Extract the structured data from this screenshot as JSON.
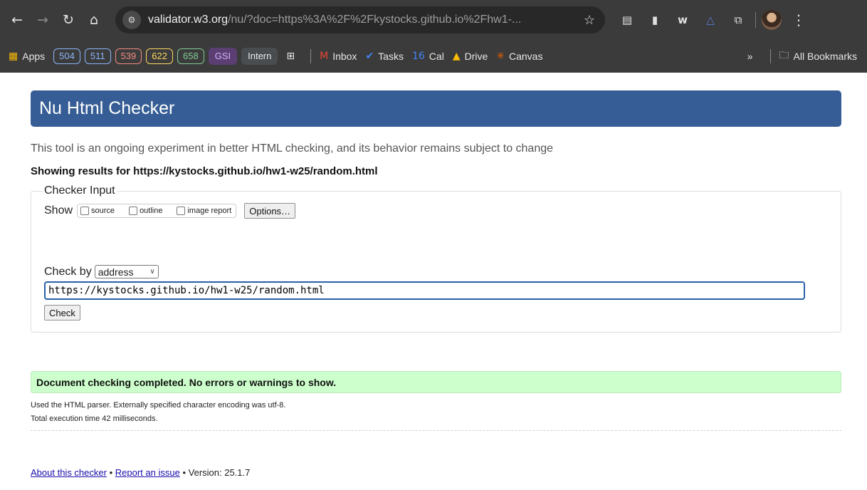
{
  "browser": {
    "url_host": "validator.w3.org",
    "url_path": "/nu/?doc=https%3A%2F%2Fkystocks.github.io%2Fhw1-...",
    "colors": {
      "chrome_bg": "#3b3b3b",
      "omnibox_bg": "#282828"
    },
    "extensions": [
      "reader-mode-icon",
      "document-icon",
      "wave-icon",
      "triangle-icon",
      "extensions-puzzle-icon"
    ]
  },
  "bookmarks": {
    "apps_label": "Apps",
    "pills": [
      {
        "label": "504",
        "color": "#8ab4f8"
      },
      {
        "label": "511",
        "color": "#8ab4f8"
      },
      {
        "label": "539",
        "color": "#f28b82"
      },
      {
        "label": "622",
        "color": "#fdd663"
      },
      {
        "label": "658",
        "color": "#81c995"
      },
      {
        "label": "GSI",
        "color": "#d7aefb",
        "filled": true,
        "bg": "#5b3f73"
      },
      {
        "label": "Intern",
        "color": "#e8eaed",
        "filled": true,
        "bg": "#4a4d50"
      }
    ],
    "links": [
      {
        "label": "Inbox",
        "icon": "M"
      },
      {
        "label": "Tasks",
        "icon": "✔"
      },
      {
        "label": "Cal",
        "icon": "16"
      },
      {
        "label": "Drive",
        "icon": "▲"
      },
      {
        "label": "Canvas",
        "icon": "✳"
      }
    ],
    "overflow_label": "»",
    "all_bookmarks_label": "All Bookmarks"
  },
  "page": {
    "title": "Nu Html Checker",
    "lead": "This tool is an ongoing experiment in better HTML checking, and its behavior remains subject to change",
    "results_heading": "Showing results for https://kystocks.github.io/hw1-w25/random.html",
    "checker": {
      "legend": "Checker Input",
      "show_label": "Show",
      "options": [
        "source",
        "outline",
        "image report"
      ],
      "options_button": "Options…",
      "check_by_label": "Check by",
      "check_by_value": "address",
      "address_value": "https://kystocks.github.io/hw1-w25/random.html",
      "check_button": "Check"
    },
    "status_message": "Document checking completed. No errors or warnings to show.",
    "details": [
      "Used the HTML parser. Externally specified character encoding was utf-8.",
      "Total execution time 42 milliseconds."
    ],
    "footer": {
      "about_link": "About this checker",
      "separator": "•",
      "report_link": "Report an issue",
      "version_text": "Version: 25.1.7"
    },
    "colors": {
      "banner": "#365d95",
      "success_bg": "#ccffcc",
      "link": "#1a0dab"
    }
  }
}
